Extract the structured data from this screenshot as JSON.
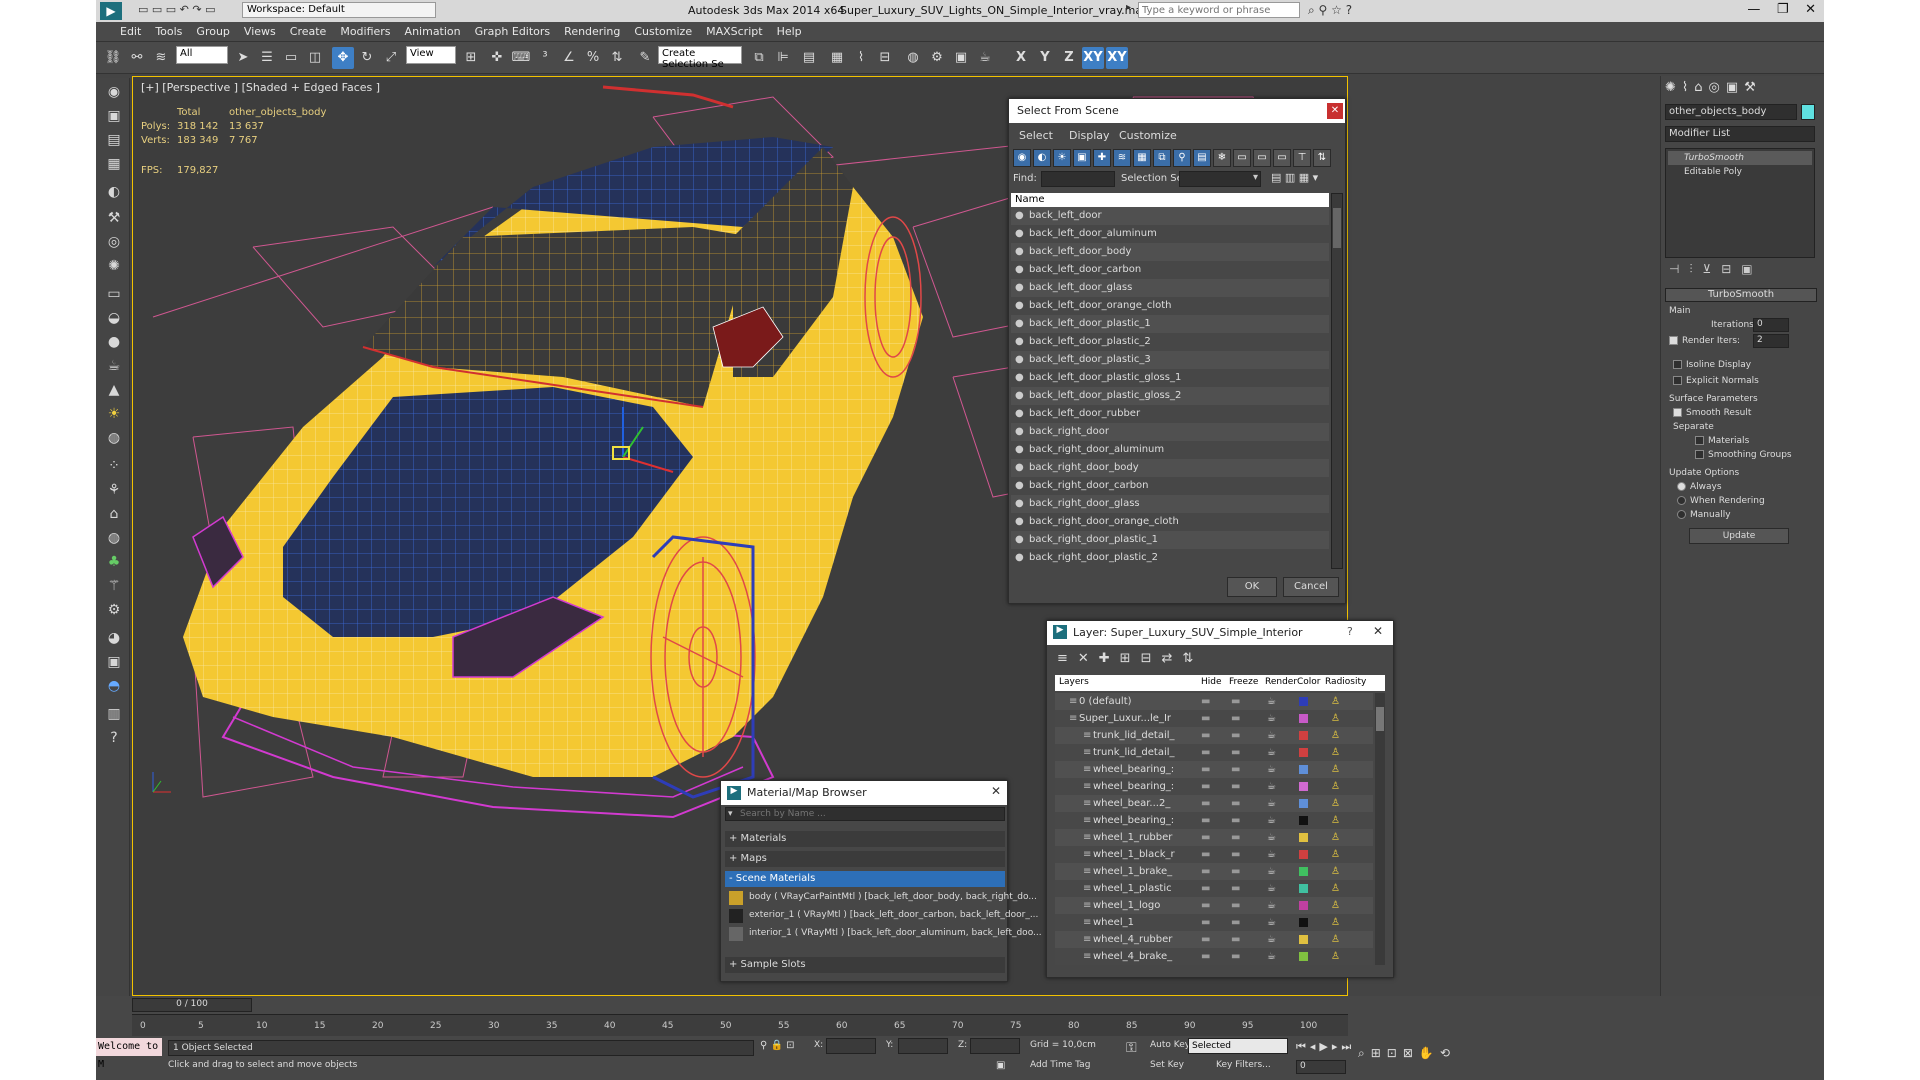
{
  "title_bar": {
    "workspace": "Workspace: Default",
    "app": "Autodesk 3ds Max  2014 x64",
    "file": "Super_Luxury_SUV_Lights_ON_Simple_Interior_vray.max",
    "search_placeholder": "Type a keyword or phrase"
  },
  "menus": [
    "Edit",
    "Tools",
    "Group",
    "Views",
    "Create",
    "Modifiers",
    "Animation",
    "Graph Editors",
    "Rendering",
    "Customize",
    "MAXScript",
    "Help"
  ],
  "toolbar": {
    "filter": "All",
    "coord": "View",
    "selection_set": "Create Selection Se",
    "axes": [
      "X",
      "Y",
      "Z",
      "XY",
      "XY"
    ]
  },
  "viewport": {
    "label": "[+] [Perspective ] [Shaded + Edged Faces ]",
    "stats": {
      "total_label": "Total",
      "object_label": "other_objects_body",
      "polys_label": "Polys:",
      "polys_total": "318 142",
      "polys_obj": "13 637",
      "verts_label": "Verts:",
      "verts_total": "183 349",
      "verts_obj": "7 767",
      "fps_label": "FPS:",
      "fps": "179,827"
    }
  },
  "select_dialog": {
    "title": "Select From Scene",
    "tabs": [
      "Select",
      "Display",
      "Customize"
    ],
    "find_label": "Find:",
    "selset_label": "Selection Set:",
    "column": "Name",
    "items": [
      "back_left_door",
      "back_left_door_aluminum",
      "back_left_door_body",
      "back_left_door_carbon",
      "back_left_door_glass",
      "back_left_door_orange_cloth",
      "back_left_door_plastic_1",
      "back_left_door_plastic_2",
      "back_left_door_plastic_3",
      "back_left_door_plastic_gloss_1",
      "back_left_door_plastic_gloss_2",
      "back_left_door_rubber",
      "back_right_door",
      "back_right_door_aluminum",
      "back_right_door_body",
      "back_right_door_carbon",
      "back_right_door_glass",
      "back_right_door_orange_cloth",
      "back_right_door_plastic_1",
      "back_right_door_plastic_2"
    ],
    "ok": "OK",
    "cancel": "Cancel"
  },
  "layer_dialog": {
    "title": "Layer: Super_Luxury_SUV_Simple_Interior",
    "columns": [
      "Layers",
      "Hide",
      "Freeze",
      "Render",
      "Color",
      "Radiosity"
    ],
    "rows": [
      {
        "name": "0 (default)",
        "color": "#2e3db8"
      },
      {
        "name": "Super_Luxur...le_Ir",
        "color": "#c85ac8"
      },
      {
        "name": "trunk_lid_detail_",
        "color": "#d04040"
      },
      {
        "name": "trunk_lid_detail_",
        "color": "#d04040"
      },
      {
        "name": "wheel_bearing_:",
        "color": "#5f8fd8"
      },
      {
        "name": "wheel_bearing_:",
        "color": "#d06ad0"
      },
      {
        "name": "wheel_bear...2_",
        "color": "#5f8fd8"
      },
      {
        "name": "wheel_bearing_:",
        "color": "#111111"
      },
      {
        "name": "wheel_1_rubber",
        "color": "#e0c040"
      },
      {
        "name": "wheel_1_black_r",
        "color": "#d04040"
      },
      {
        "name": "wheel_1_brake_",
        "color": "#40c060"
      },
      {
        "name": "wheel_1_plastic",
        "color": "#40c0a0"
      },
      {
        "name": "wheel_1_logo",
        "color": "#c040a0"
      },
      {
        "name": "wheel_1",
        "color": "#111111"
      },
      {
        "name": "wheel_4_rubber",
        "color": "#e0c040"
      },
      {
        "name": "wheel_4_brake_",
        "color": "#80c040"
      }
    ]
  },
  "material_browser": {
    "title": "Material/Map Browser",
    "search_placeholder": "Search by Name ...",
    "groups": [
      "+ Materials",
      "+ Maps",
      "- Scene Materials"
    ],
    "materials": [
      "body ( VRayCarPaintMtl ) [back_left_door_body, back_right_do...",
      "exterior_1 ( VRayMtl ) [back_left_door_carbon, back_left_door_...",
      "interior_1 ( VRayMtl ) [back_left_door_aluminum, back_left_doo..."
    ],
    "sample_slots": "+ Sample Slots"
  },
  "command_panel": {
    "object_name": "other_objects_body",
    "modifier_list": "Modifier List",
    "stack": [
      "TurboSmooth",
      "Editable Poly"
    ],
    "rollout": "TurboSmooth",
    "main": "Main",
    "iterations_label": "Iterations:",
    "iterations": "0",
    "render_iters_label": "Render Iters:",
    "render_iters": "2",
    "isoline": "Isoline Display",
    "explicit": "Explicit Normals",
    "surface_params": "Surface Parameters",
    "smooth_result": "Smooth Result",
    "separate": "Separate",
    "materials": "Materials",
    "smoothing": "Smoothing Groups",
    "update_options": "Update Options",
    "always": "Always",
    "when_rendering": "When Rendering",
    "manually": "Manually",
    "update": "Update"
  },
  "timeline": {
    "frame": "0 / 100",
    "ticks": [
      "0",
      "5",
      "10",
      "15",
      "20",
      "25",
      "30",
      "35",
      "40",
      "45",
      "50",
      "55",
      "60",
      "65",
      "70",
      "75",
      "80",
      "85",
      "90",
      "95",
      "100"
    ]
  },
  "status": {
    "maxscript": "Welcome to M",
    "selected": "1 Object Selected",
    "prompt": "Click and drag to select and move objects",
    "x_label": "X:",
    "y_label": "Y:",
    "z_label": "Z:",
    "grid": "Grid = 10,0cm",
    "add_time_tag": "Add Time Tag",
    "auto_key": "Auto Key",
    "set_key": "Set Key",
    "selected_mode": "Selected",
    "key_filters": "Key Filters...",
    "frame_field": "0"
  }
}
